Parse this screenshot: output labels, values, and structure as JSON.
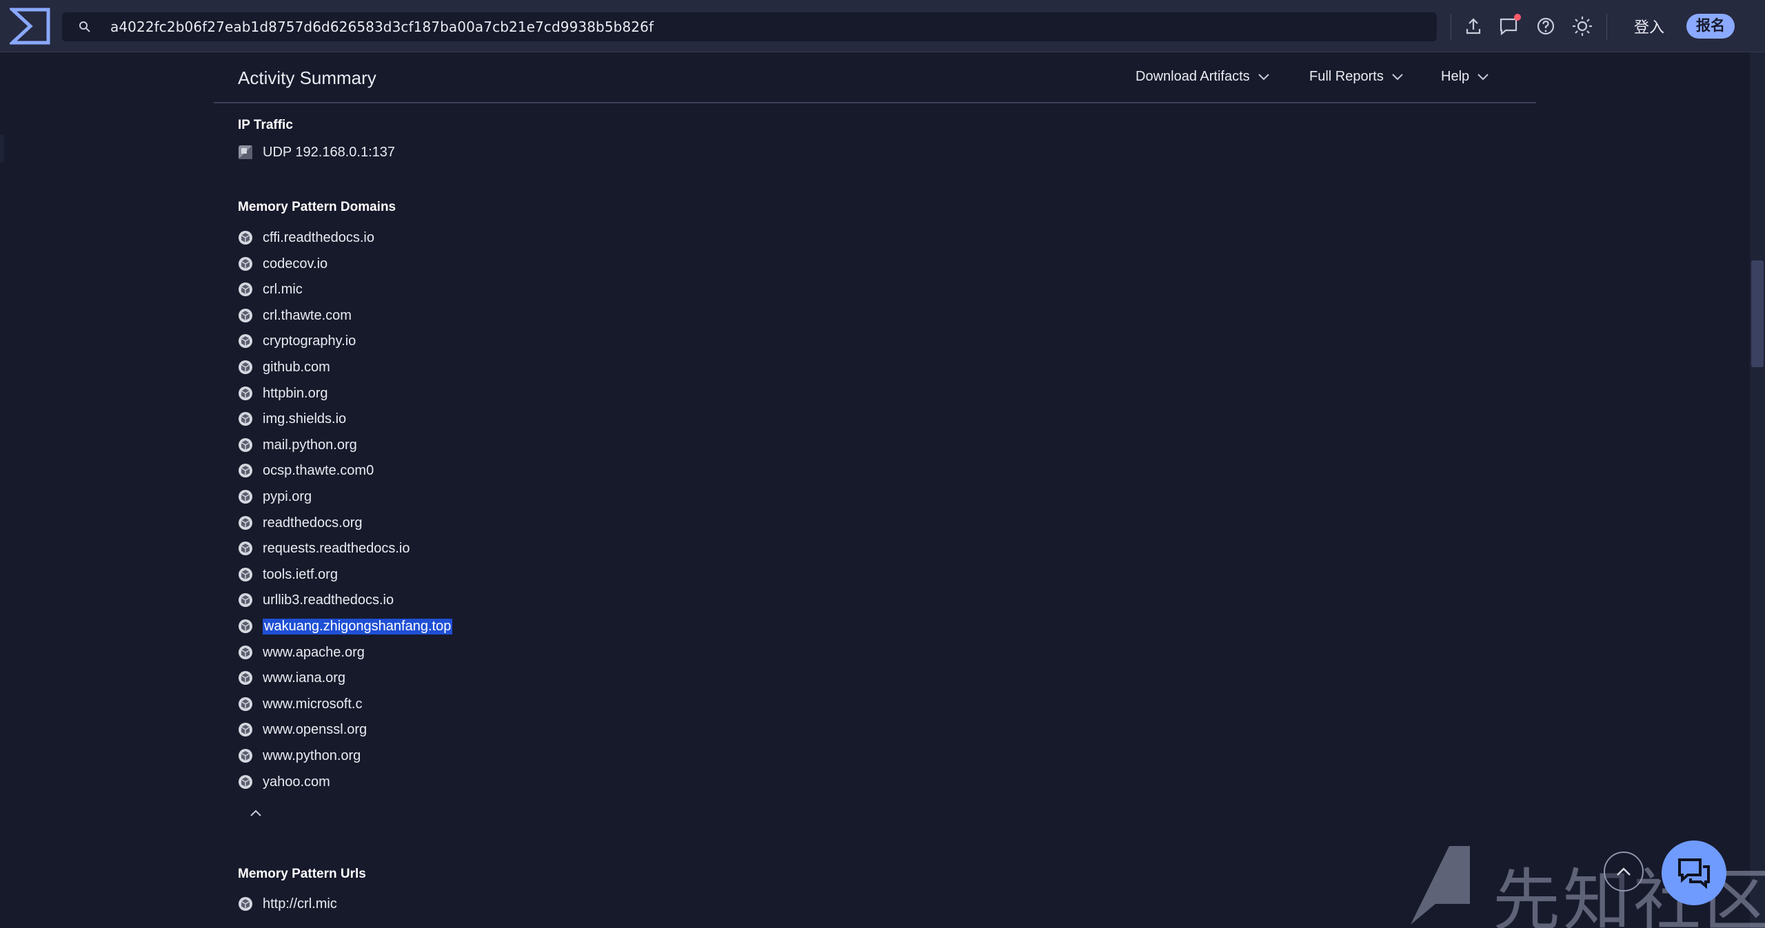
{
  "header": {
    "search_value": "a4022fc2b06f27eab1d8757d6d626583d3cf187ba00a7cb21e7cd9938b5b826f",
    "login_label": "登入",
    "signup_label": "报名",
    "icons": [
      "upload-icon",
      "comment-icon",
      "help-icon",
      "theme-sun-icon"
    ]
  },
  "activity": {
    "title": "Activity Summary",
    "menus": [
      {
        "label": "Download Artifacts"
      },
      {
        "label": "Full Reports"
      },
      {
        "label": "Help"
      }
    ]
  },
  "ip_traffic": {
    "title": "IP Traffic",
    "items": [
      "UDP 192.168.0.1:137"
    ]
  },
  "memory_pattern_domains": {
    "title": "Memory Pattern Domains",
    "items": [
      "cffi.readthedocs.io",
      "codecov.io",
      "crl.mic",
      "crl.thawte.com",
      "cryptography.io",
      "github.com",
      "httpbin.org",
      "img.shields.io",
      "mail.python.org",
      "ocsp.thawte.com0",
      "pypi.org",
      "readthedocs.org",
      "requests.readthedocs.io",
      "tools.ietf.org",
      "urllib3.readthedocs.io",
      "wakuang.zhigongshanfang.top",
      "www.apache.org",
      "www.iana.org",
      "www.microsoft.c",
      "www.openssl.org",
      "www.python.org",
      "yahoo.com"
    ],
    "selected_item": "wakuang.zhigongshanfang.top"
  },
  "memory_pattern_urls": {
    "title": "Memory Pattern Urls",
    "items": [
      "http://crl.mic"
    ]
  },
  "watermark": {
    "text": "先知社区"
  },
  "colors": {
    "background": "#171a2b",
    "topbar": "#262a3f",
    "accent": "#8aa9ff",
    "selection": "#1f4fd4"
  }
}
